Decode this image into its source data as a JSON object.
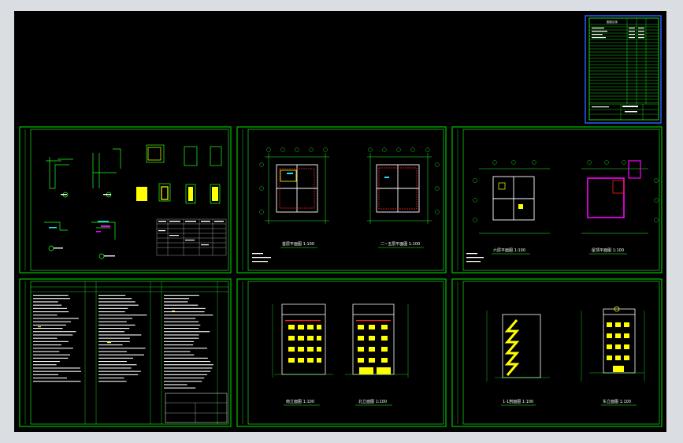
{
  "app": {
    "background": "#000000",
    "frame_color": "#00c000",
    "line_color": "#22ff22",
    "accent_yellow": "#ffff00",
    "accent_magenta": "#ff00ff",
    "accent_red": "#ff2020",
    "index_frame_color": "#2a5cff"
  },
  "sheets": [
    {
      "id": "details",
      "captions": []
    },
    {
      "id": "floor-plans-1",
      "captions": [
        "首层平面图 1:100",
        "二~五层平面图 1:100"
      ]
    },
    {
      "id": "floor-plans-2",
      "captions": [
        "六层平面图 1:100",
        "屋顶平面图 1:100"
      ]
    },
    {
      "id": "notes",
      "captions": []
    },
    {
      "id": "elevations-1",
      "captions": [
        "南立面图 1:100",
        "北立面图 1:100"
      ]
    },
    {
      "id": "elevations-2",
      "captions": [
        "1-1剖面图 1:100",
        "东立面图 1:100"
      ]
    }
  ],
  "index_sheet": {
    "title": "图纸目录"
  }
}
